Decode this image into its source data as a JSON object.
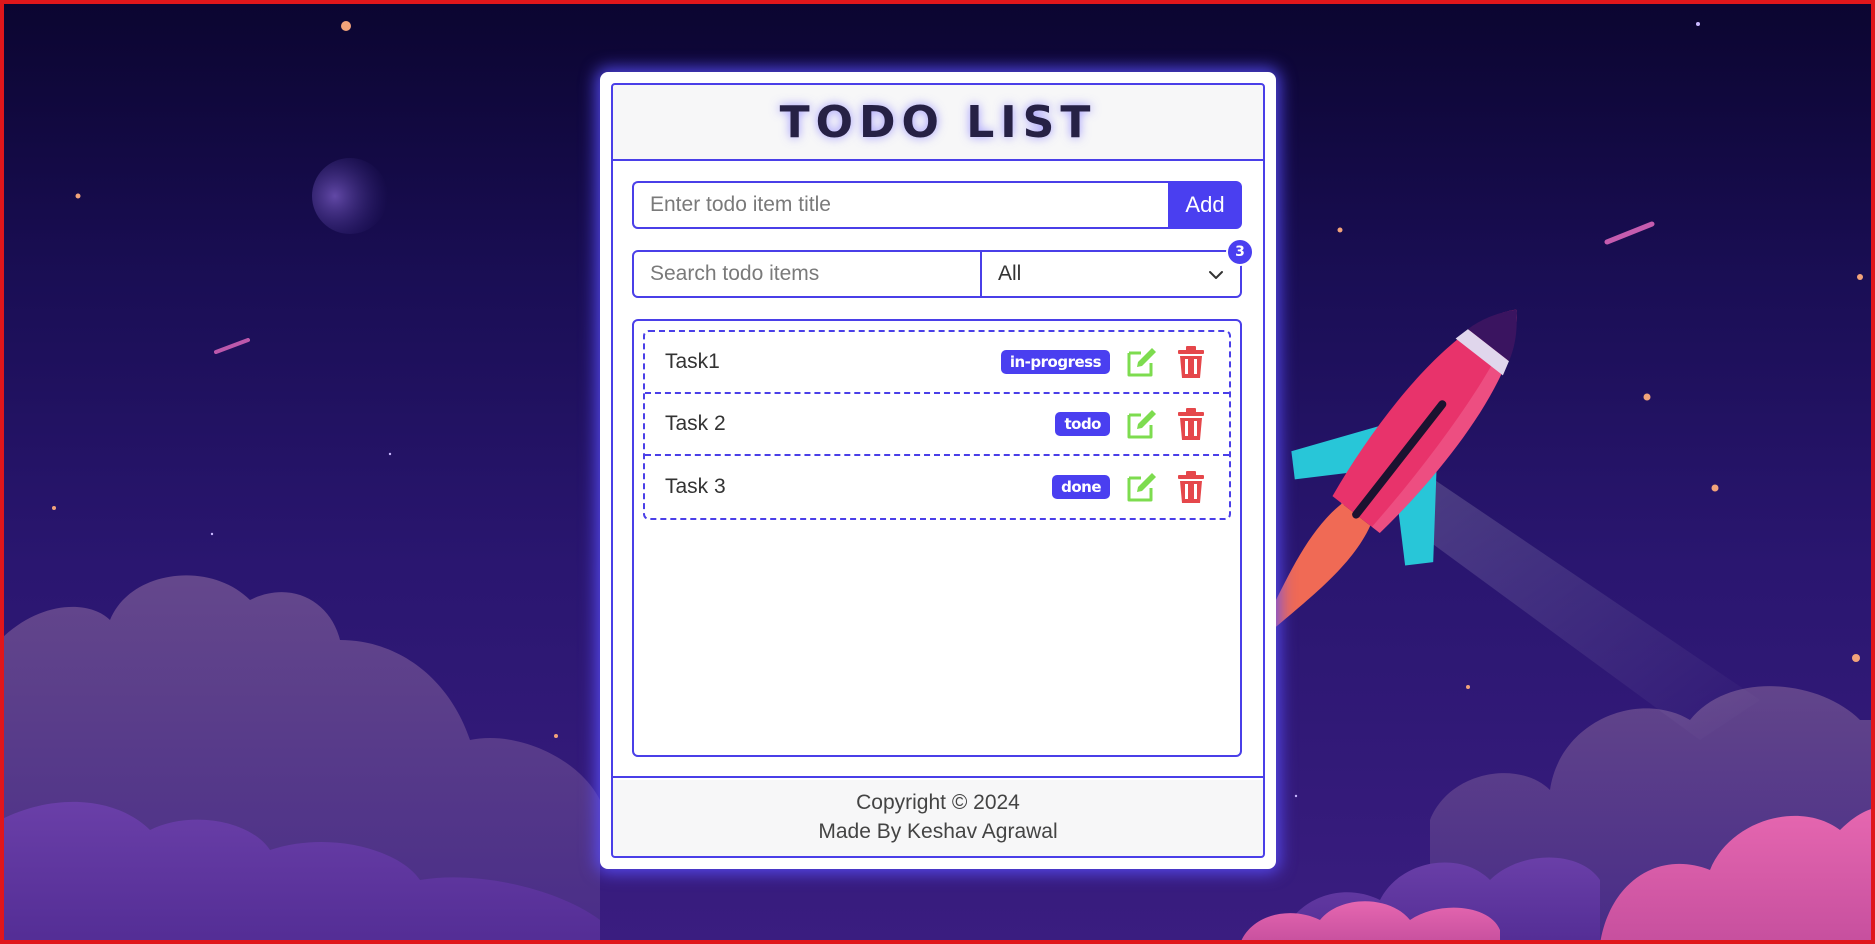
{
  "app": {
    "title": "TODO LIST"
  },
  "add_form": {
    "placeholder": "Enter todo item title",
    "value": "",
    "button_label": "Add"
  },
  "filter": {
    "search_placeholder": "Search todo items",
    "search_value": "",
    "selected": "All",
    "count": "3"
  },
  "todos": [
    {
      "title": "Task1",
      "status": "in-progress",
      "edit_icon": "edit-icon",
      "delete_icon": "trash-icon"
    },
    {
      "title": "Task 2",
      "status": "todo",
      "edit_icon": "edit-icon",
      "delete_icon": "trash-icon"
    },
    {
      "title": "Task 3",
      "status": "done",
      "edit_icon": "edit-icon",
      "delete_icon": "trash-icon"
    }
  ],
  "footer": {
    "copyright": "Copyright © 2024",
    "author": "Made By Keshav Agrawal"
  },
  "colors": {
    "accent": "#4a3ff0",
    "edit": "#7ddc4f",
    "delete": "#e5474b",
    "frame_border": "#e0161b"
  }
}
